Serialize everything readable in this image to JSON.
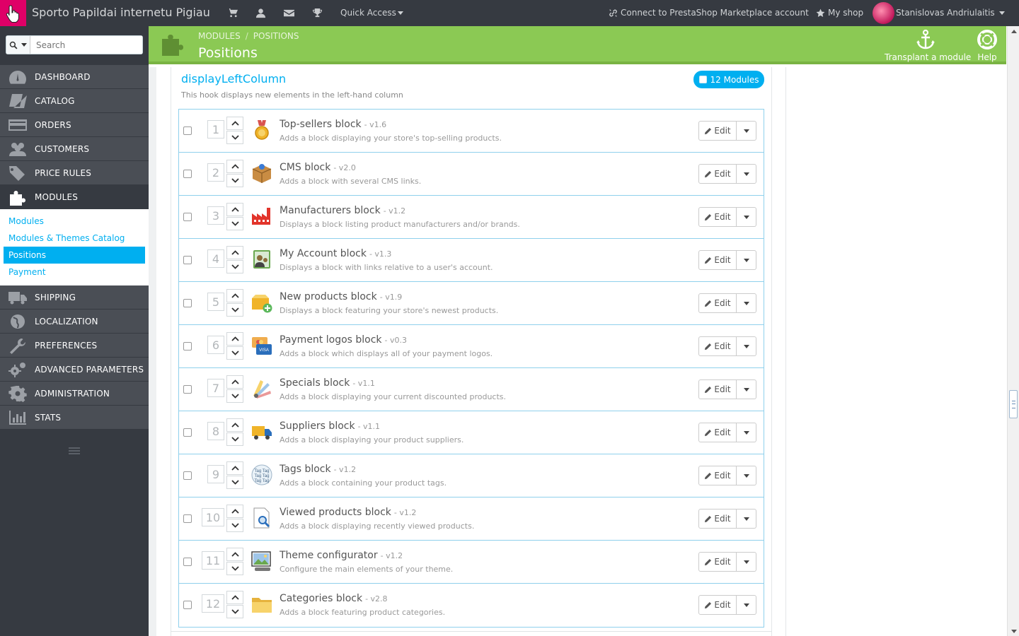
{
  "topbar": {
    "shop_name": "Sporto Papildai internetu Pigiau",
    "icons": [
      "cart-icon",
      "user-icon",
      "envelope-icon",
      "trophy-icon"
    ],
    "quick_access": "Quick Access",
    "connect": "Connect to PrestaShop Marketplace account",
    "my_shop": "My shop",
    "user_name": "Stanislovas Andriulaitis"
  },
  "search": {
    "placeholder": "Search"
  },
  "sidebar": {
    "items_top": [
      {
        "label": "DASHBOARD",
        "icon": "dashboard-icon"
      },
      {
        "label": "CATALOG",
        "icon": "book-icon"
      },
      {
        "label": "ORDERS",
        "icon": "credit-card-icon"
      },
      {
        "label": "CUSTOMERS",
        "icon": "users-icon"
      },
      {
        "label": "PRICE RULES",
        "icon": "tags-icon"
      },
      {
        "label": "MODULES",
        "icon": "puzzle-icon"
      }
    ],
    "submenu": [
      {
        "label": "Modules"
      },
      {
        "label": "Modules & Themes Catalog"
      },
      {
        "label": "Positions"
      },
      {
        "label": "Payment"
      }
    ],
    "items_bottom": [
      {
        "label": "SHIPPING",
        "icon": "truck-icon"
      },
      {
        "label": "LOCALIZATION",
        "icon": "globe-icon"
      },
      {
        "label": "PREFERENCES",
        "icon": "wrench-icon"
      },
      {
        "label": "ADVANCED PARAMETERS",
        "icon": "cogs-icon"
      },
      {
        "label": "ADMINISTRATION",
        "icon": "cog-icon"
      },
      {
        "label": "STATS",
        "icon": "bar-chart-icon"
      }
    ]
  },
  "header": {
    "breadcrumb": [
      "MODULES",
      "POSITIONS"
    ],
    "title": "Positions",
    "transplant": "Transplant a module",
    "help": "Help"
  },
  "hook": {
    "name": "displayLeftColumn",
    "description": "This hook displays new elements in the left-hand column",
    "badge": "12 Modules"
  },
  "edit_label": "Edit",
  "modules": [
    {
      "pos": "1",
      "name": "Top-sellers block",
      "version": "- v1.6",
      "desc": "Adds a block displaying your store's top-selling products.",
      "icon": "medal-icon"
    },
    {
      "pos": "2",
      "name": "CMS block",
      "version": "- v2.0",
      "desc": "Adds a block with several CMS links.",
      "icon": "box-icon"
    },
    {
      "pos": "3",
      "name": "Manufacturers block",
      "version": "- v1.2",
      "desc": "Displays a block listing product manufacturers and/or brands.",
      "icon": "factory-icon"
    },
    {
      "pos": "4",
      "name": "My Account block",
      "version": "- v1.3",
      "desc": "Displays a block with links relative to a user's account.",
      "icon": "account-icon"
    },
    {
      "pos": "5",
      "name": "New products block",
      "version": "- v1.9",
      "desc": "Displays a block featuring your store's newest products.",
      "icon": "new-box-icon"
    },
    {
      "pos": "6",
      "name": "Payment logos block",
      "version": "- v0.3",
      "desc": "Adds a block which displays all of your payment logos.",
      "icon": "cards-icon"
    },
    {
      "pos": "7",
      "name": "Specials block",
      "version": "- v1.1",
      "desc": "Adds a block displaying your current discounted products.",
      "icon": "palette-icon"
    },
    {
      "pos": "8",
      "name": "Suppliers block",
      "version": "- v1.1",
      "desc": "Adds a block displaying your product suppliers.",
      "icon": "truck-icon"
    },
    {
      "pos": "9",
      "name": "Tags block",
      "version": "- v1.2",
      "desc": "Adds a block containing your product tags.",
      "icon": "tags-cloud-icon"
    },
    {
      "pos": "10",
      "name": "Viewed products block",
      "version": "- v1.2",
      "desc": "Adds a block displaying recently viewed products.",
      "icon": "magnifier-doc-icon"
    },
    {
      "pos": "11",
      "name": "Theme configurator",
      "version": "- v1.2",
      "desc": "Configure the main elements of your theme.",
      "icon": "picture-icon"
    },
    {
      "pos": "12",
      "name": "Categories block",
      "version": "- v2.8",
      "desc": "Adds a block featuring product categories.",
      "icon": "folder-icon"
    }
  ]
}
